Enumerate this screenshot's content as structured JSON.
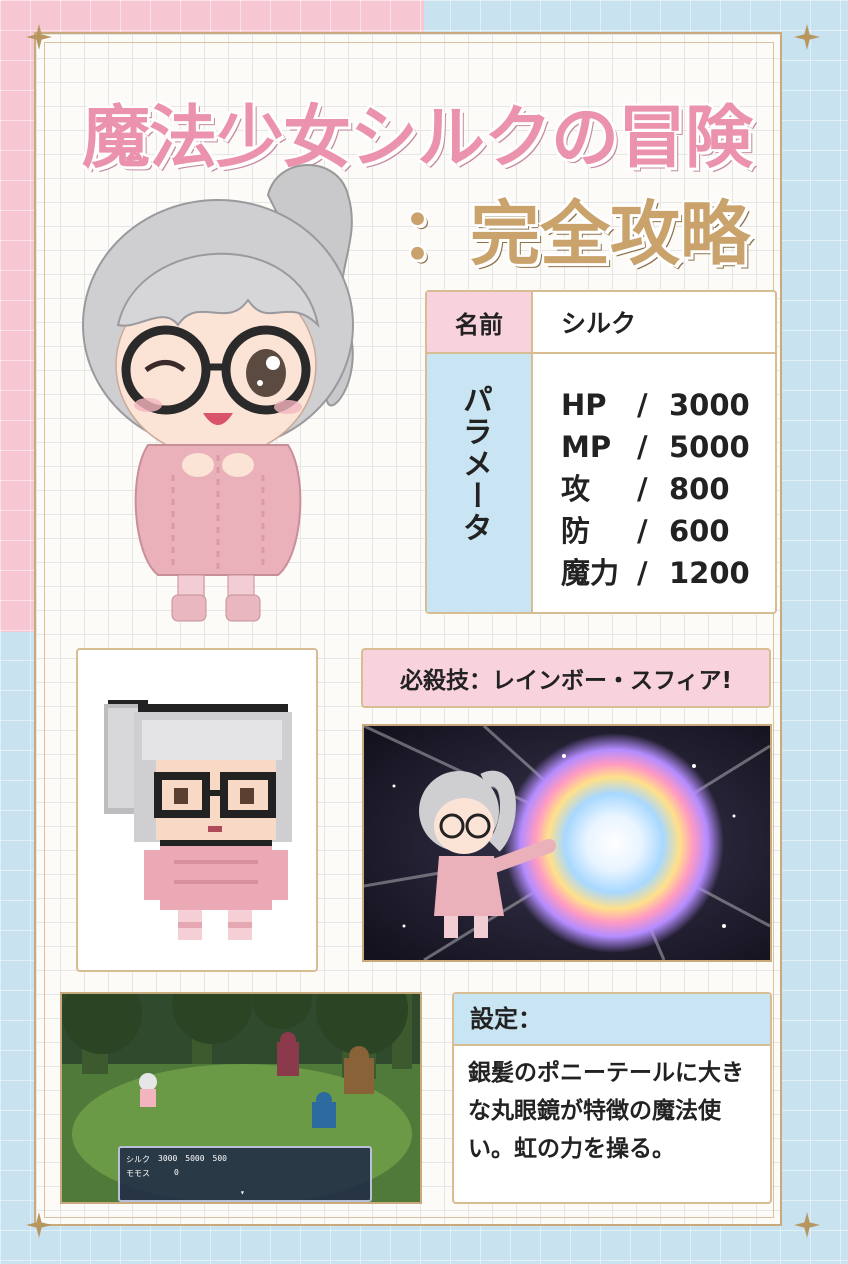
{
  "title": {
    "line1": "魔法少女シルクの冒険",
    "line2": "：完全攻略"
  },
  "profile": {
    "name_label": "名前",
    "name_value": "シルク",
    "param_label": "パラメータ",
    "stats": [
      {
        "key": "HP",
        "sep": "/",
        "value": "3000"
      },
      {
        "key": "MP",
        "sep": "/",
        "value": "5000"
      },
      {
        "key": "攻",
        "sep": "/",
        "value": "800"
      },
      {
        "key": "防",
        "sep": "/",
        "value": "600"
      },
      {
        "key": "魔力",
        "sep": "/",
        "value": "1200"
      }
    ]
  },
  "special": {
    "label": "必殺技：レインボー・スフィア!"
  },
  "setting": {
    "header": "設定：",
    "description": "銀髪のポニーテールに大きな丸眼鏡が特徴の魔法使い。虹の力を操る。"
  },
  "battle_hud": {
    "rows": [
      {
        "name": "シルク",
        "hp": "3000",
        "mp": "5000",
        "ap": "500"
      },
      {
        "name": "モモス",
        "hp": "",
        "mp": "",
        "ap": "0"
      }
    ]
  },
  "colors": {
    "pink": "#f6c7d3",
    "blue": "#c8e2f0",
    "title_pink": "#eb92ad",
    "title_gold": "#c9a36b",
    "border_gold": "#c9aa7c"
  }
}
